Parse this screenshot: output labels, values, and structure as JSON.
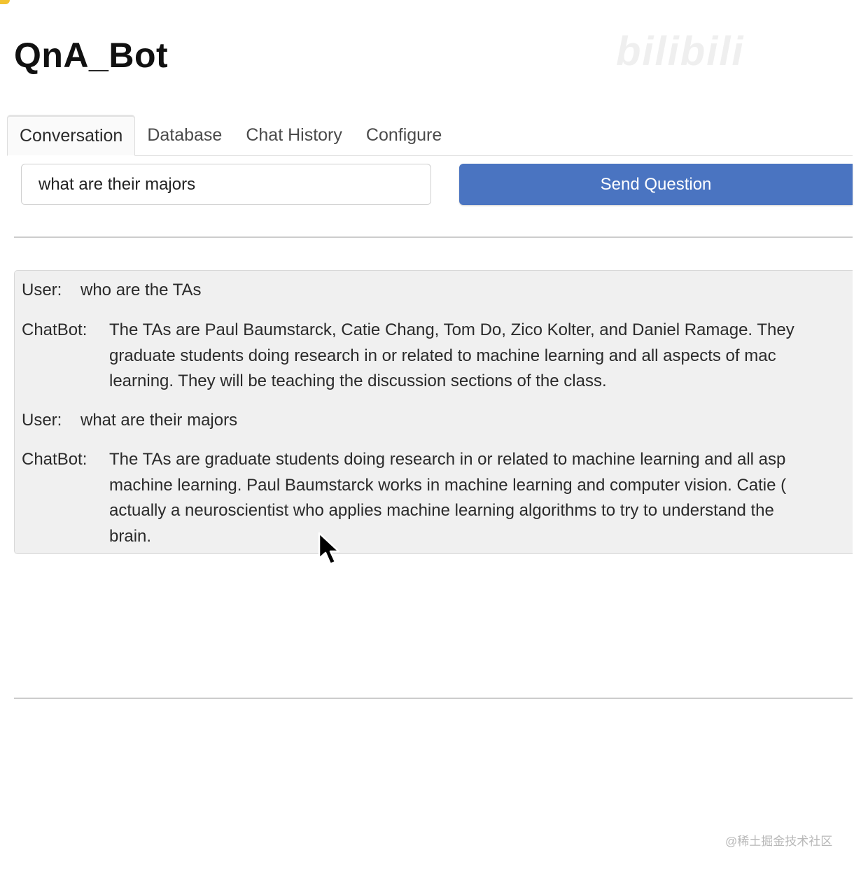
{
  "app": {
    "title": "QnA_Bot"
  },
  "watermarks": {
    "top": "bilibili",
    "bottom": "@稀土掘金技术社区"
  },
  "tabs": [
    {
      "label": "Conversation",
      "active": true
    },
    {
      "label": "Database",
      "active": false
    },
    {
      "label": "Chat History",
      "active": false
    },
    {
      "label": "Configure",
      "active": false
    }
  ],
  "question": {
    "value": "what are their majors",
    "send_label": "Send Question"
  },
  "conversation": [
    {
      "speaker": "User:",
      "lines": [
        "who are the TAs"
      ]
    },
    {
      "speaker": "ChatBot:",
      "lines": [
        "The TAs are Paul Baumstarck, Catie Chang, Tom Do, Zico Kolter, and Daniel Ramage. They",
        "graduate students doing research in or related to machine learning and all aspects of mac",
        "learning. They will be teaching the discussion sections of the class."
      ]
    },
    {
      "speaker": "User:",
      "lines": [
        "what are their majors"
      ]
    },
    {
      "speaker": "ChatBot:",
      "lines": [
        "The TAs are graduate students doing research in or related to machine learning and all asp",
        "machine learning. Paul Baumstarck works in machine learning and computer vision. Catie (",
        "actually a neuroscientist who applies machine learning algorithms to try to understand the",
        "brain."
      ]
    }
  ],
  "colors": {
    "accent": "#4a74c1",
    "chat_background": "#f0f0f0"
  }
}
